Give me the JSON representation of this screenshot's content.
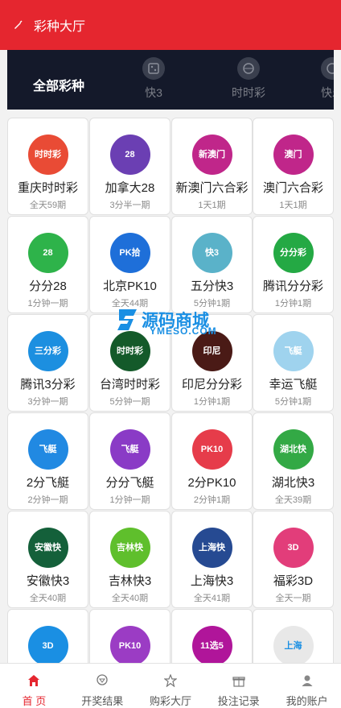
{
  "header": {
    "title": "彩种大厅"
  },
  "tabs": {
    "all_label": "全部彩种",
    "items": [
      {
        "label": "快3",
        "icon": "dice-icon"
      },
      {
        "label": "时时彩",
        "icon": "ball-icon"
      },
      {
        "label": "快乐",
        "icon": "ball-icon"
      }
    ]
  },
  "games": [
    {
      "name": "重庆时时彩",
      "sub": "全天59期",
      "icon_text": "时时彩",
      "color": "#e94b35"
    },
    {
      "name": "加拿大28",
      "sub": "3分半一期",
      "icon_text": "28",
      "color": "#6b3fb3"
    },
    {
      "name": "新澳门六合彩",
      "sub": "1天1期",
      "icon_text": "新澳门",
      "color": "#c0268a"
    },
    {
      "name": "澳门六合彩",
      "sub": "1天1期",
      "icon_text": "澳门",
      "color": "#c0268a"
    },
    {
      "name": "分分28",
      "sub": "1分钟一期",
      "icon_text": "28",
      "color": "#2eb34a"
    },
    {
      "name": "北京PK10",
      "sub": "全天44期",
      "icon_text": "PK拾",
      "color": "#1e6fd9"
    },
    {
      "name": "五分快3",
      "sub": "5分钟1期",
      "icon_text": "快3",
      "color": "#5ab2c9"
    },
    {
      "name": "腾讯分分彩",
      "sub": "1分钟1期",
      "icon_text": "分分彩",
      "color": "#24a944"
    },
    {
      "name": "腾讯3分彩",
      "sub": "3分钟一期",
      "icon_text": "三分彩",
      "color": "#1c8fe0"
    },
    {
      "name": "台湾时时彩",
      "sub": "5分钟一期",
      "icon_text": "时时彩",
      "color": "#145a2a"
    },
    {
      "name": "印尼分分彩",
      "sub": "1分钟1期",
      "icon_text": "印尼",
      "color": "#4a1a16"
    },
    {
      "name": "幸运飞艇",
      "sub": "5分钟1期",
      "icon_text": "飞艇",
      "color": "#9fd3ee"
    },
    {
      "name": "2分飞艇",
      "sub": "2分钟一期",
      "icon_text": "飞艇",
      "color": "#2189e2"
    },
    {
      "name": "分分飞艇",
      "sub": "1分钟一期",
      "icon_text": "飞艇",
      "color": "#8a3bc6"
    },
    {
      "name": "2分PK10",
      "sub": "2分钟1期",
      "icon_text": "PK10",
      "color": "#e63c4a"
    },
    {
      "name": "湖北快3",
      "sub": "全天39期",
      "icon_text": "湖北快",
      "color": "#33a945"
    },
    {
      "name": "安徽快3",
      "sub": "全天40期",
      "icon_text": "安徽快",
      "color": "#14603a"
    },
    {
      "name": "吉林快3",
      "sub": "全天40期",
      "icon_text": "吉林快",
      "color": "#5fbf2c"
    },
    {
      "name": "上海快3",
      "sub": "全天41期",
      "icon_text": "上海快",
      "color": "#264a92"
    },
    {
      "name": "福彩3D",
      "sub": "全天一期",
      "icon_text": "3D",
      "color": "#e23d7a"
    },
    {
      "name": "",
      "sub": "",
      "icon_text": "3D",
      "color": "#1a8fe3"
    },
    {
      "name": "",
      "sub": "",
      "icon_text": "PK10",
      "color": "#9b3cc4"
    },
    {
      "name": "",
      "sub": "",
      "icon_text": "11选5",
      "color": "#b0159a"
    },
    {
      "name": "",
      "sub": "",
      "icon_text": "上海",
      "color": "#e8e8e8"
    }
  ],
  "watermark": {
    "text": "源码商城",
    "sub": "YMESO.COM"
  },
  "bottom_nav": [
    {
      "label": "首 页",
      "icon": "home-icon",
      "active": true
    },
    {
      "label": "开奖结果",
      "icon": "trophy-icon",
      "active": false
    },
    {
      "label": "购彩大厅",
      "icon": "star-icon",
      "active": false
    },
    {
      "label": "投注记录",
      "icon": "gift-icon",
      "active": false
    },
    {
      "label": "我的账户",
      "icon": "user-icon",
      "active": false
    }
  ]
}
